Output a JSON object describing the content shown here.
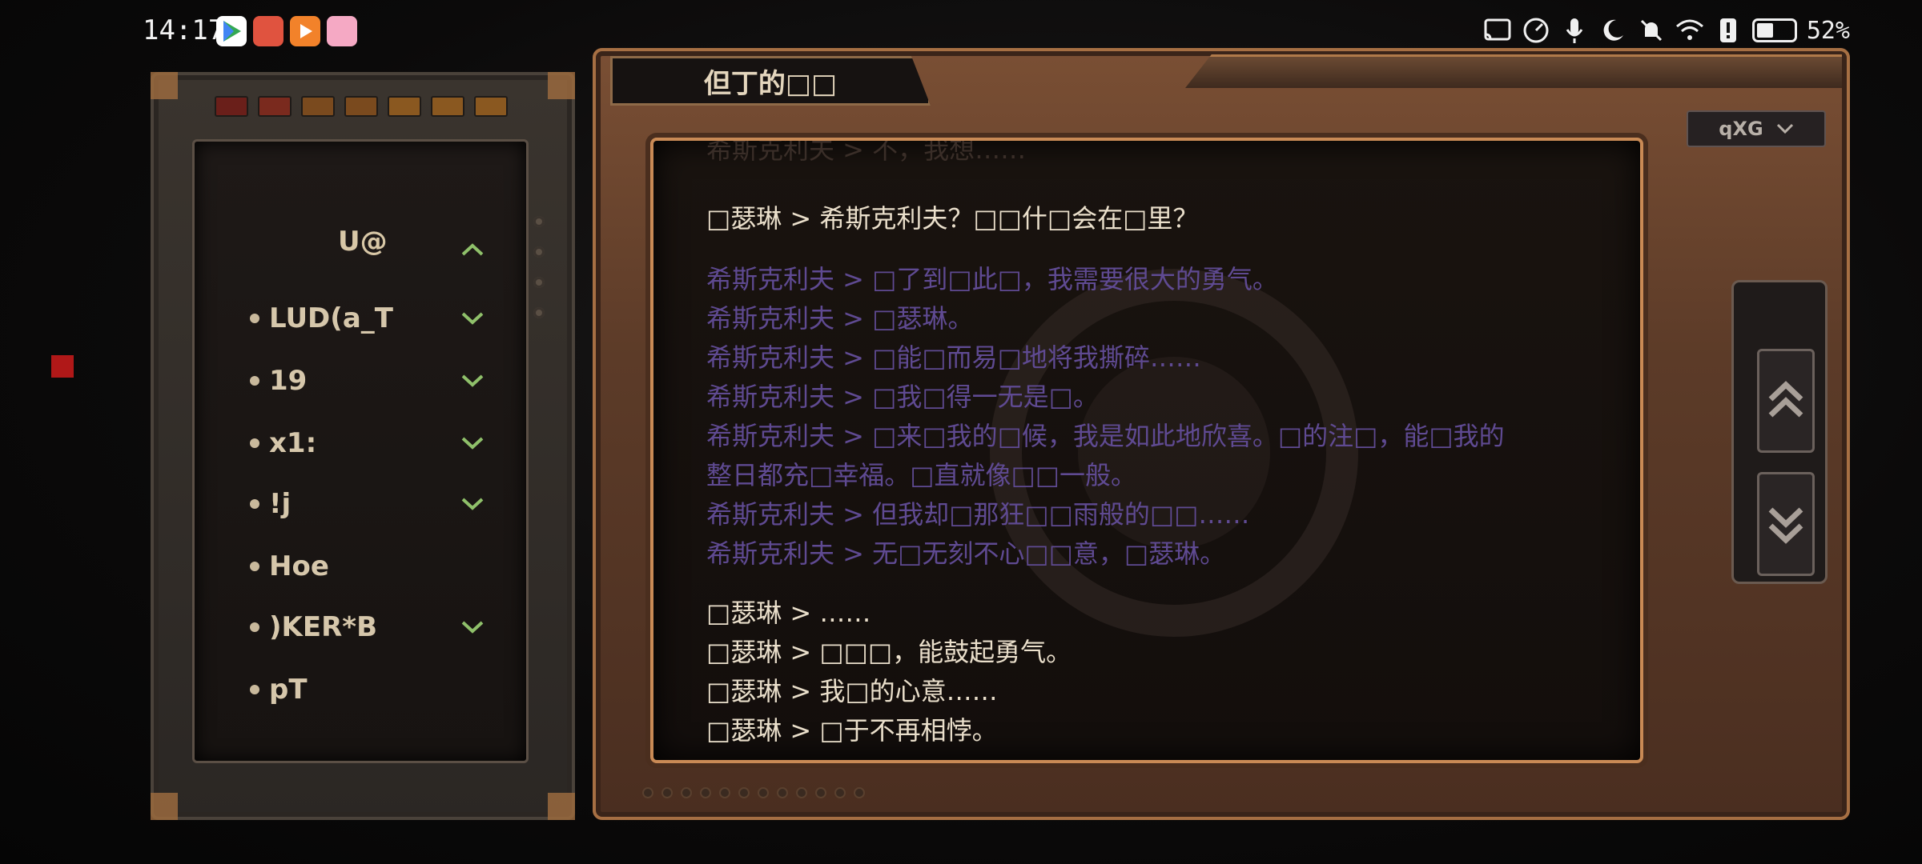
{
  "status_bar": {
    "time": "14:17",
    "battery_percent_text": "52%",
    "battery_level": 0.52,
    "app_icons": [
      "play-store-icon",
      "huawei-app-icon",
      "video-app-icon",
      "bilibili-app-icon"
    ],
    "system_icons": [
      "cast-icon",
      "speed-icon",
      "mic-icon",
      "moon-icon",
      "mute-bell-icon",
      "wifi-icon",
      "alert-icon"
    ]
  },
  "sidebar": {
    "title": "U@",
    "items": [
      {
        "label": "LUD(a_T",
        "has_chevron": true
      },
      {
        "label": "19",
        "has_chevron": true
      },
      {
        "label": "x1:",
        "has_chevron": true
      },
      {
        "label": "!j",
        "has_chevron": true
      },
      {
        "label": "Hoe",
        "has_chevron": false
      },
      {
        "label": ")KER*B",
        "has_chevron": true
      },
      {
        "label": "pT",
        "has_chevron": false
      }
    ]
  },
  "header": {
    "title": "但丁的□□",
    "dropdown_label": "qXG"
  },
  "dialog": {
    "lines": [
      {
        "text": "希斯克利夫 > 不，我想……",
        "style": "faded"
      },
      {
        "text": "□瑟琳 > 希斯克利夫？□□什□会在□里？",
        "style": "cream"
      },
      {
        "text": "希斯克利夫 > □了到□此□，我需要很大的勇气。",
        "style": "purple"
      },
      {
        "text": "希斯克利夫 > □瑟琳。",
        "style": "purple"
      },
      {
        "text": "希斯克利夫 > □能□而易□地将我撕碎……",
        "style": "purple"
      },
      {
        "text": "希斯克利夫 > □我□得一无是□。",
        "style": "purple"
      },
      {
        "text": "希斯克利夫 > □来□我的□候，我是如此地欣喜。□的注□，能□我的",
        "style": "purple"
      },
      {
        "text": "整日都充□幸福。□直就像□□一般。",
        "style": "purple"
      },
      {
        "text": "希斯克利夫 > 但我却□那狂□□雨般的□□……",
        "style": "purple"
      },
      {
        "text": "希斯克利夫 > 无□无刻不心□□意，□瑟琳。",
        "style": "purple"
      },
      {
        "text": "□瑟琳 > ……",
        "style": "cream"
      },
      {
        "text": "□瑟琳 > □□□，能鼓起勇气。",
        "style": "cream"
      },
      {
        "text": "□瑟琳 > 我□的心意……",
        "style": "cream"
      },
      {
        "text": "□瑟琳 > □于不再相悖。",
        "style": "cream"
      }
    ]
  },
  "colors": {
    "dialog_cream": "#eadfcb",
    "dialog_purple": "#5f4a92",
    "frame_copper": "#c98a55",
    "chevron_green": "#8fc06a"
  }
}
